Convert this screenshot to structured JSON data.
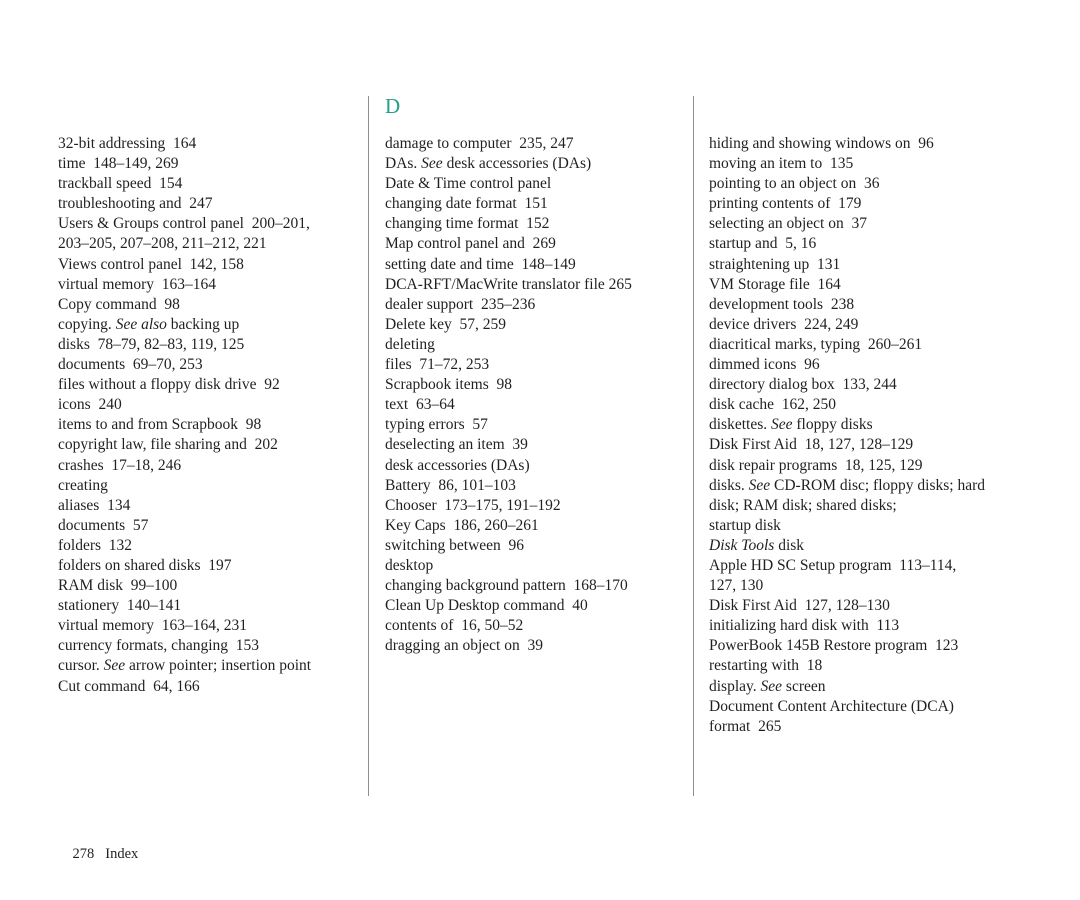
{
  "page": {
    "folio": "278",
    "running_head": "Index",
    "background_color": "#ffffff",
    "text_color": "#231f20",
    "rule_color": "#8c9094"
  },
  "columns": [
    {
      "id": "column-1",
      "letter_heading": null,
      "entries": [
        {
          "level": 1,
          "text": "32-bit addressing  164"
        },
        {
          "level": 1,
          "text": "time  148–149, 269"
        },
        {
          "level": 1,
          "text": "trackball speed  154"
        },
        {
          "level": 1,
          "text": "troubleshooting and  247"
        },
        {
          "level": 1,
          "text": "Users & Groups control panel  200–201,"
        },
        {
          "level": 3,
          "text": "203–205, 207–208, 211–212, 221"
        },
        {
          "level": 1,
          "text": "Views control panel  142, 158"
        },
        {
          "level": 1,
          "text": "virtual memory  163–164"
        },
        {
          "level": 0,
          "text": "Copy command  98"
        },
        {
          "level": 0,
          "text": "copying. ",
          "italic": "See also",
          "after": " backing up"
        },
        {
          "level": 1,
          "text": "disks  78–79, 82–83, 119, 125"
        },
        {
          "level": 1,
          "text": "documents  69–70, 253"
        },
        {
          "level": 1,
          "text": "files without a floppy disk drive  92"
        },
        {
          "level": 1,
          "text": "icons  240"
        },
        {
          "level": 1,
          "text": "items to and from Scrapbook  98"
        },
        {
          "level": 0,
          "text": "copyright law, file sharing and  202"
        },
        {
          "level": 0,
          "text": "crashes  17–18, 246"
        },
        {
          "level": 0,
          "text": "creating"
        },
        {
          "level": 1,
          "text": "aliases  134"
        },
        {
          "level": 1,
          "text": "documents  57"
        },
        {
          "level": 1,
          "text": "folders  132"
        },
        {
          "level": 1,
          "text": "folders on shared disks  197"
        },
        {
          "level": 1,
          "text": "RAM disk  99–100"
        },
        {
          "level": 1,
          "text": "stationery  140–141"
        },
        {
          "level": 1,
          "text": "virtual memory  163–164, 231"
        },
        {
          "level": 0,
          "text": "currency formats, changing  153"
        },
        {
          "level": 0,
          "text": "cursor. ",
          "italic": "See",
          "after": " arrow pointer; insertion point"
        },
        {
          "level": 0,
          "text": "Cut command  64, 166"
        }
      ]
    },
    {
      "id": "column-2",
      "letter_heading": "D",
      "letter_heading_color": "#279e8c",
      "entries": [
        {
          "level": 0,
          "text": "damage to computer  235, 247"
        },
        {
          "level": 0,
          "text": "DAs. ",
          "italic": "See",
          "after": " desk accessories (DAs)"
        },
        {
          "level": 0,
          "text": "Date & Time control panel"
        },
        {
          "level": 1,
          "text": "changing date format  151"
        },
        {
          "level": 1,
          "text": "changing time format  152"
        },
        {
          "level": 1,
          "text": "Map control panel and  269"
        },
        {
          "level": 1,
          "text": "setting date and time  148–149"
        },
        {
          "level": 0,
          "text": "DCA-RFT/MacWrite translator file 265"
        },
        {
          "level": 0,
          "text": "dealer support  235–236"
        },
        {
          "level": 0,
          "text": "Delete key  57, 259"
        },
        {
          "level": 0,
          "text": "deleting"
        },
        {
          "level": 1,
          "text": "files  71–72, 253"
        },
        {
          "level": 1,
          "text": "Scrapbook items  98"
        },
        {
          "level": 1,
          "text": "text  63–64"
        },
        {
          "level": 1,
          "text": "typing errors  57"
        },
        {
          "level": 0,
          "text": "deselecting an item  39"
        },
        {
          "level": 0,
          "text": "desk accessories (DAs)"
        },
        {
          "level": 1,
          "text": "Battery  86, 101–103"
        },
        {
          "level": 1,
          "text": "Chooser  173–175, 191–192"
        },
        {
          "level": 1,
          "text": "Key Caps  186, 260–261"
        },
        {
          "level": 1,
          "text": "switching between  96"
        },
        {
          "level": 0,
          "text": "desktop"
        },
        {
          "level": 1,
          "text": "changing background pattern  168–170"
        },
        {
          "level": 1,
          "text": "Clean Up Desktop command  40"
        },
        {
          "level": 1,
          "text": "contents of  16, 50–52"
        },
        {
          "level": 1,
          "text": "dragging an object on  39"
        }
      ]
    },
    {
      "id": "column-3",
      "letter_heading": null,
      "entries": [
        {
          "level": 1,
          "text": "hiding and showing windows on  96"
        },
        {
          "level": 1,
          "text": "moving an item to  135"
        },
        {
          "level": 1,
          "text": "pointing to an object on  36"
        },
        {
          "level": 1,
          "text": "printing contents of  179"
        },
        {
          "level": 1,
          "text": "selecting an object on  37"
        },
        {
          "level": 1,
          "text": "startup and  5, 16"
        },
        {
          "level": 1,
          "text": "straightening up  131"
        },
        {
          "level": 1,
          "text": "VM Storage file  164"
        },
        {
          "level": 0,
          "text": "development tools  238"
        },
        {
          "level": 0,
          "text": "device drivers  224, 249"
        },
        {
          "level": 0,
          "text": "diacritical marks, typing  260–261"
        },
        {
          "level": 0,
          "text": "dimmed icons  96"
        },
        {
          "level": 0,
          "text": "directory dialog box  133, 244"
        },
        {
          "level": 0,
          "text": "disk cache  162, 250"
        },
        {
          "level": 0,
          "text": "diskettes. ",
          "italic": "See",
          "after": " floppy disks"
        },
        {
          "level": 0,
          "text": "Disk First Aid  18, 127, 128–129"
        },
        {
          "level": 0,
          "text": "disk repair programs  18, 125, 129"
        },
        {
          "level": 0,
          "text": "disks. ",
          "italic": "See",
          "after": " CD-ROM disc; floppy disks; hard"
        },
        {
          "level": 3,
          "text": "disk; RAM disk; shared disks;"
        },
        {
          "level": 3,
          "text": "startup disk"
        },
        {
          "level": 0,
          "italic": "Disk Tools",
          "after": " disk"
        },
        {
          "level": 1,
          "text": "Apple HD SC Setup program  113–114,"
        },
        {
          "level": 2,
          "text": "127, 130"
        },
        {
          "level": 1,
          "text": "Disk First Aid  127, 128–130"
        },
        {
          "level": 1,
          "text": "initializing hard disk with  113"
        },
        {
          "level": 1,
          "text": "PowerBook 145B Restore program  123"
        },
        {
          "level": 1,
          "text": "restarting with  18"
        },
        {
          "level": 0,
          "text": "display. ",
          "italic": "See",
          "after": " screen"
        },
        {
          "level": 0,
          "text": "Document Content Architecture (DCA)"
        },
        {
          "level": 3,
          "text": "format  265"
        }
      ]
    }
  ]
}
